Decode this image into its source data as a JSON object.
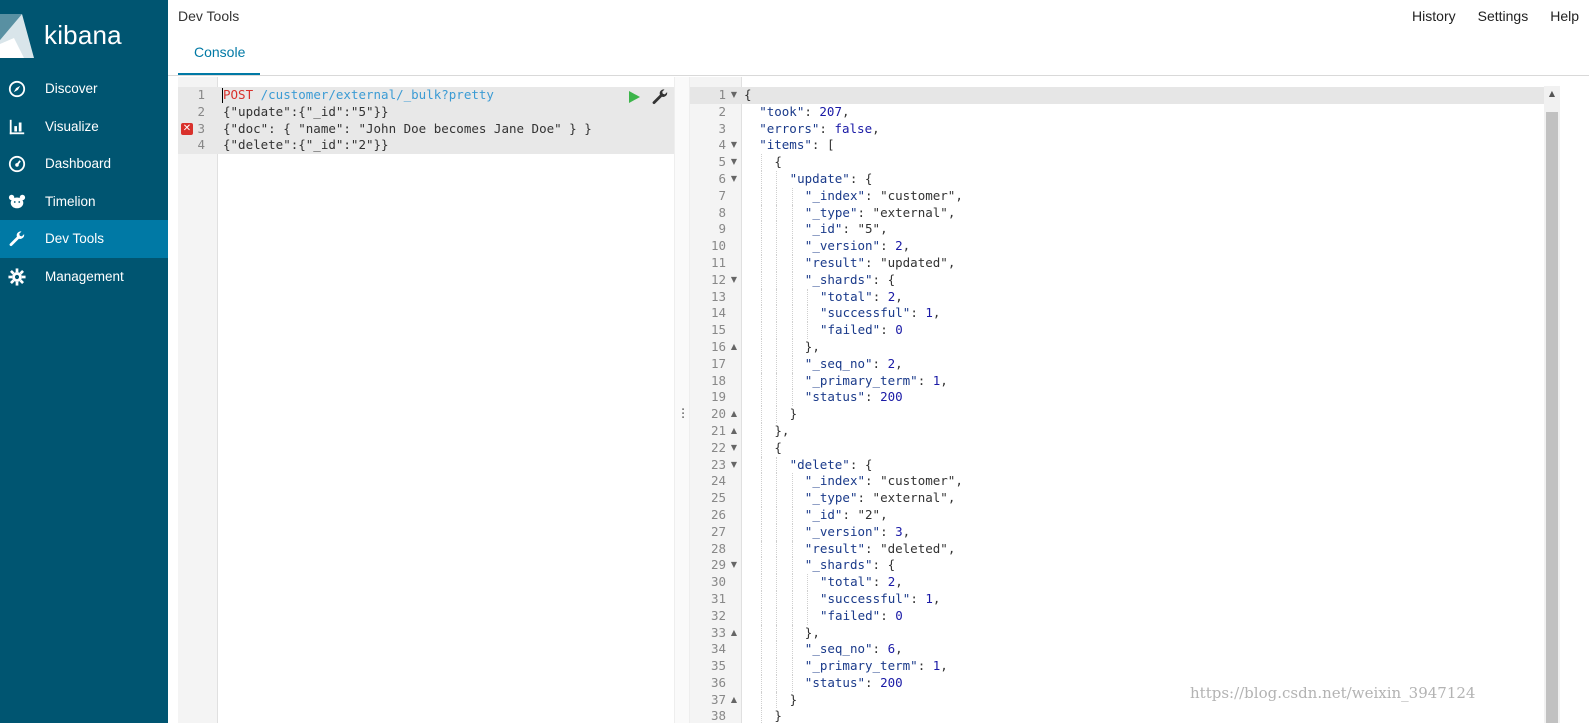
{
  "app": {
    "brand": "kibana",
    "title": "Dev Tools"
  },
  "top_links": [
    "History",
    "Settings",
    "Help"
  ],
  "tabs": [
    {
      "label": "Console"
    }
  ],
  "nav": [
    {
      "label": "Discover",
      "icon": "compass-icon"
    },
    {
      "label": "Visualize",
      "icon": "bar-chart-icon"
    },
    {
      "label": "Dashboard",
      "icon": "dashboard-gauge-icon"
    },
    {
      "label": "Timelion",
      "icon": "timelion-bear-icon"
    },
    {
      "label": "Dev Tools",
      "icon": "wrench-icon",
      "active": true
    },
    {
      "label": "Management",
      "icon": "gear-icon"
    }
  ],
  "colors": {
    "sidebar": "#005571",
    "sidebar_active": "#0079a5",
    "accent": "#0079a5",
    "method": "#d9312c",
    "url": "#3b9bd4",
    "play": "#3cb54a",
    "error": "#d9312c"
  },
  "request_editor": {
    "lines": [
      {
        "n": "1",
        "method": "POST",
        "url": " /customer/external/_bulk?pretty"
      },
      {
        "n": "2",
        "text": "{\"update\":{\"_id\":\"5\"}}"
      },
      {
        "n": "3",
        "text": "{\"doc\": { \"name\": \"John Doe becomes Jane Doe\" } }",
        "error": true
      },
      {
        "n": "4",
        "text": "{\"delete\":{\"_id\":\"2\"}}"
      }
    ]
  },
  "response_editor": {
    "lines": [
      {
        "n": "1",
        "fold": "down",
        "indent": 0,
        "text": "{"
      },
      {
        "n": "2",
        "indent": 1,
        "key": "took",
        "val": "207",
        "vt": "num",
        "comma": true
      },
      {
        "n": "3",
        "indent": 1,
        "key": "errors",
        "val": "false",
        "vt": "bool",
        "comma": true
      },
      {
        "n": "4",
        "fold": "down",
        "indent": 1,
        "key": "items",
        "val": "[",
        "vt": "punct"
      },
      {
        "n": "5",
        "fold": "down",
        "indent": 2,
        "text": "{"
      },
      {
        "n": "6",
        "fold": "down",
        "indent": 3,
        "key": "update",
        "val": "{",
        "vt": "punct"
      },
      {
        "n": "7",
        "indent": 4,
        "key": "_index",
        "val": "\"customer\"",
        "vt": "str",
        "comma": true
      },
      {
        "n": "8",
        "indent": 4,
        "key": "_type",
        "val": "\"external\"",
        "vt": "str",
        "comma": true
      },
      {
        "n": "9",
        "indent": 4,
        "key": "_id",
        "val": "\"5\"",
        "vt": "str",
        "comma": true
      },
      {
        "n": "10",
        "indent": 4,
        "key": "_version",
        "val": "2",
        "vt": "num",
        "comma": true
      },
      {
        "n": "11",
        "indent": 4,
        "key": "result",
        "val": "\"updated\"",
        "vt": "str",
        "comma": true
      },
      {
        "n": "12",
        "fold": "down",
        "indent": 4,
        "key": "_shards",
        "val": "{",
        "vt": "punct"
      },
      {
        "n": "13",
        "indent": 5,
        "key": "total",
        "val": "2",
        "vt": "num",
        "comma": true
      },
      {
        "n": "14",
        "indent": 5,
        "key": "successful",
        "val": "1",
        "vt": "num",
        "comma": true
      },
      {
        "n": "15",
        "indent": 5,
        "key": "failed",
        "val": "0",
        "vt": "num"
      },
      {
        "n": "16",
        "fold": "up",
        "indent": 4,
        "text": "},"
      },
      {
        "n": "17",
        "indent": 4,
        "key": "_seq_no",
        "val": "2",
        "vt": "num",
        "comma": true
      },
      {
        "n": "18",
        "indent": 4,
        "key": "_primary_term",
        "val": "1",
        "vt": "num",
        "comma": true
      },
      {
        "n": "19",
        "indent": 4,
        "key": "status",
        "val": "200",
        "vt": "num"
      },
      {
        "n": "20",
        "fold": "up",
        "indent": 3,
        "text": "}"
      },
      {
        "n": "21",
        "fold": "up",
        "indent": 2,
        "text": "},"
      },
      {
        "n": "22",
        "fold": "down",
        "indent": 2,
        "text": "{"
      },
      {
        "n": "23",
        "fold": "down",
        "indent": 3,
        "key": "delete",
        "val": "{",
        "vt": "punct"
      },
      {
        "n": "24",
        "indent": 4,
        "key": "_index",
        "val": "\"customer\"",
        "vt": "str",
        "comma": true
      },
      {
        "n": "25",
        "indent": 4,
        "key": "_type",
        "val": "\"external\"",
        "vt": "str",
        "comma": true
      },
      {
        "n": "26",
        "indent": 4,
        "key": "_id",
        "val": "\"2\"",
        "vt": "str",
        "comma": true
      },
      {
        "n": "27",
        "indent": 4,
        "key": "_version",
        "val": "3",
        "vt": "num",
        "comma": true
      },
      {
        "n": "28",
        "indent": 4,
        "key": "result",
        "val": "\"deleted\"",
        "vt": "str",
        "comma": true
      },
      {
        "n": "29",
        "fold": "down",
        "indent": 4,
        "key": "_shards",
        "val": "{",
        "vt": "punct"
      },
      {
        "n": "30",
        "indent": 5,
        "key": "total",
        "val": "2",
        "vt": "num",
        "comma": true
      },
      {
        "n": "31",
        "indent": 5,
        "key": "successful",
        "val": "1",
        "vt": "num",
        "comma": true
      },
      {
        "n": "32",
        "indent": 5,
        "key": "failed",
        "val": "0",
        "vt": "num"
      },
      {
        "n": "33",
        "fold": "up",
        "indent": 4,
        "text": "},"
      },
      {
        "n": "34",
        "indent": 4,
        "key": "_seq_no",
        "val": "6",
        "vt": "num",
        "comma": true
      },
      {
        "n": "35",
        "indent": 4,
        "key": "_primary_term",
        "val": "1",
        "vt": "num",
        "comma": true
      },
      {
        "n": "36",
        "indent": 4,
        "key": "status",
        "val": "200",
        "vt": "num"
      },
      {
        "n": "37",
        "fold": "up",
        "indent": 3,
        "text": "}"
      },
      {
        "n": "38",
        "indent": 2,
        "text": "}"
      }
    ]
  },
  "watermark": "https://blog.csdn.net/weixin_3947124"
}
